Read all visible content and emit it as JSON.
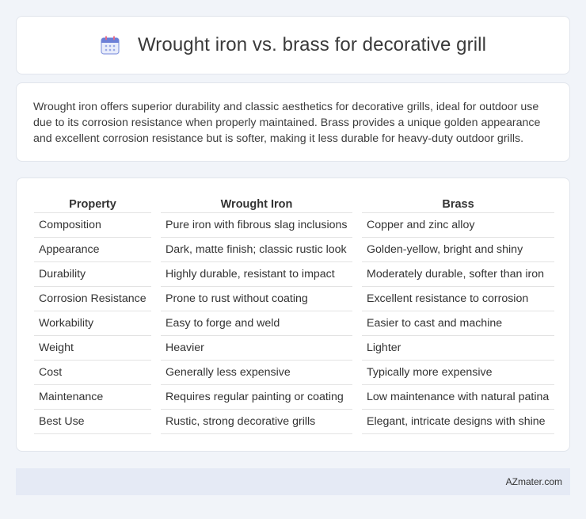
{
  "header": {
    "title": "Wrought iron vs. brass for decorative grill",
    "icon": "calendar-icon",
    "icon_color": "#6b7fd7"
  },
  "summary": {
    "text": "Wrought iron offers superior durability and classic aesthetics for decorative grills, ideal for outdoor use due to its corrosion resistance when properly maintained. Brass provides a unique golden appearance and excellent corrosion resistance but is softer, making it less durable for heavy-duty outdoor grills."
  },
  "table": {
    "headers": [
      "Property",
      "Wrought Iron",
      "Brass"
    ],
    "rows": [
      [
        "Composition",
        "Pure iron with fibrous slag inclusions",
        "Copper and zinc alloy"
      ],
      [
        "Appearance",
        "Dark, matte finish; classic rustic look",
        "Golden-yellow, bright and shiny"
      ],
      [
        "Durability",
        "Highly durable, resistant to impact",
        "Moderately durable, softer than iron"
      ],
      [
        "Corrosion Resistance",
        "Prone to rust without coating",
        "Excellent resistance to corrosion"
      ],
      [
        "Workability",
        "Easy to forge and weld",
        "Easier to cast and machine"
      ],
      [
        "Weight",
        "Heavier",
        "Lighter"
      ],
      [
        "Cost",
        "Generally less expensive",
        "Typically more expensive"
      ],
      [
        "Maintenance",
        "Requires regular painting or coating",
        "Low maintenance with natural patina"
      ],
      [
        "Best Use",
        "Rustic, strong decorative grills",
        "Elegant, intricate designs with shine"
      ]
    ]
  },
  "footer": {
    "text": "AZmater.com"
  }
}
